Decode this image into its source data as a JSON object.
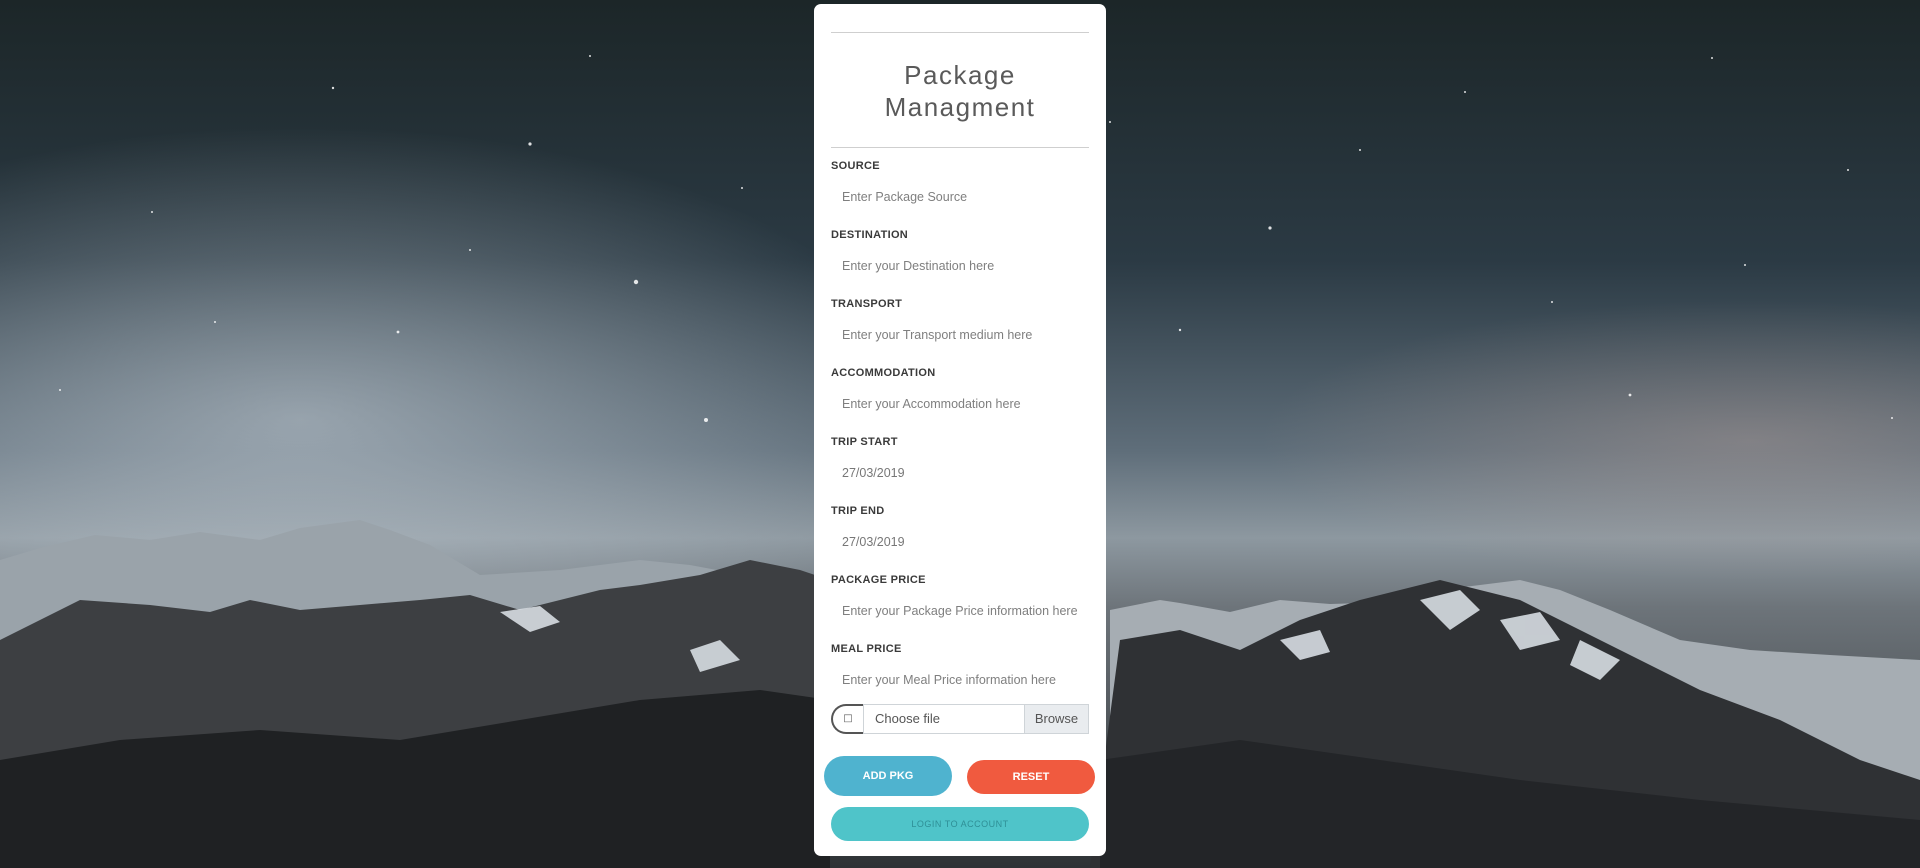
{
  "page": {
    "title": "Package Managment"
  },
  "form": {
    "fields": [
      {
        "label": "SOURCE",
        "placeholder": "Enter Package Source",
        "value": ""
      },
      {
        "label": "DESTINATION",
        "placeholder": "Enter your Destination here",
        "value": ""
      },
      {
        "label": "TRANSPORT",
        "placeholder": "Enter your Transport medium here",
        "value": ""
      },
      {
        "label": "ACCOMMODATION",
        "placeholder": "Enter your Accommodation here",
        "value": ""
      },
      {
        "label": "TRIP START",
        "placeholder": "",
        "value": "27/03/2019"
      },
      {
        "label": "TRIP END",
        "placeholder": "",
        "value": "27/03/2019"
      },
      {
        "label": "PACKAGE PRICE",
        "placeholder": "Enter your Package Price information here",
        "value": ""
      },
      {
        "label": "MEAL PRICE",
        "placeholder": "Enter your Meal Price information here",
        "value": ""
      }
    ],
    "file": {
      "icon": "file-icon",
      "text": "Choose file",
      "browse_label": "Browse"
    },
    "buttons": {
      "add_label": "ADD PKG",
      "reset_label": "RESET",
      "login_label": "LOGIN TO ACCOUNT"
    }
  },
  "colors": {
    "add": "#4fb3cf",
    "reset": "#f05a3f",
    "login": "#4fc4c9"
  }
}
